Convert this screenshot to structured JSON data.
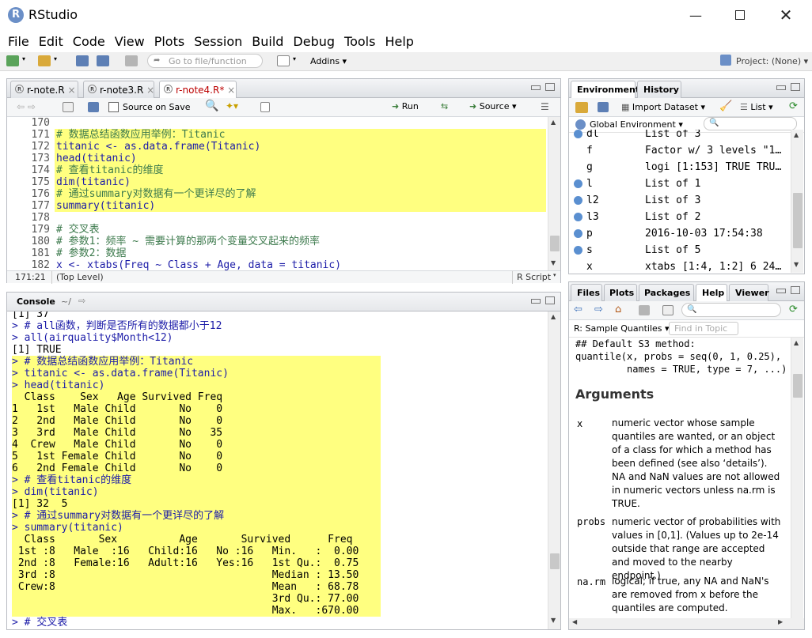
{
  "app": {
    "title": "RStudio"
  },
  "menu": [
    "File",
    "Edit",
    "Code",
    "View",
    "Plots",
    "Session",
    "Build",
    "Debug",
    "Tools",
    "Help"
  ],
  "toolbar": {
    "goto_placeholder": "Go to file/function",
    "addins": "Addins",
    "project": "Project: (None)"
  },
  "editor": {
    "tabs": [
      "r-note.R",
      "r-note3.R",
      "r-note4.R*"
    ],
    "source_on_save": "Source on Save",
    "run": "Run",
    "source": "Source",
    "lines": [
      {
        "n": "170",
        "t": "",
        "cls": ""
      },
      {
        "n": "171",
        "t": "# 数据总结函数应用举例：Titanic",
        "cls": "comment hl"
      },
      {
        "n": "172",
        "t": "titanic <- as.data.frame(Titanic)",
        "cls": "code hl"
      },
      {
        "n": "173",
        "t": "head(titanic)",
        "cls": "code hl"
      },
      {
        "n": "174",
        "t": "# 查看titanic的维度",
        "cls": "comment hl"
      },
      {
        "n": "175",
        "t": "dim(titanic)",
        "cls": "code hl"
      },
      {
        "n": "176",
        "t": "# 通过summary对数据有一个更详尽的了解",
        "cls": "comment hl"
      },
      {
        "n": "177",
        "t": "summary(titanic)",
        "cls": "code hl"
      },
      {
        "n": "178",
        "t": "",
        "cls": ""
      },
      {
        "n": "179",
        "t": "# 交叉表",
        "cls": "comment"
      },
      {
        "n": "180",
        "t": "# 参数1：频率 ~ 需要计算的那两个变量交叉起来的频率",
        "cls": "comment"
      },
      {
        "n": "181",
        "t": "# 参数2：数据",
        "cls": "comment"
      },
      {
        "n": "182",
        "t": "x <- xtabs(Freq ~ Class + Age, data = titanic)",
        "cls": "code"
      }
    ],
    "status_pos": "171:21",
    "status_level": "(Top Level)",
    "status_type": "R Script"
  },
  "console": {
    "title": "Console",
    "path": "~/",
    "lines": [
      {
        "t": "[1] 37",
        "cls": "out"
      },
      {
        "t": "> # all函数，判断是否所有的数据都小于12",
        "cls": "prompt-in"
      },
      {
        "t": "> all(airquality$Month<12)",
        "cls": "prompt-in"
      },
      {
        "t": "[1] TRUE",
        "cls": "out"
      },
      {
        "t": "> # 数据总结函数应用举例：Titanic",
        "cls": "prompt-in hl"
      },
      {
        "t": "> titanic <- as.data.frame(Titanic)",
        "cls": "prompt-in hl"
      },
      {
        "t": "> head(titanic)",
        "cls": "prompt-in hl"
      },
      {
        "t": "  Class    Sex   Age Survived Freq",
        "cls": "out hl"
      },
      {
        "t": "1   1st   Male Child       No    0",
        "cls": "out hl"
      },
      {
        "t": "2   2nd   Male Child       No    0",
        "cls": "out hl"
      },
      {
        "t": "3   3rd   Male Child       No   35",
        "cls": "out hl"
      },
      {
        "t": "4  Crew   Male Child       No    0",
        "cls": "out hl"
      },
      {
        "t": "5   1st Female Child       No    0",
        "cls": "out hl"
      },
      {
        "t": "6   2nd Female Child       No    0",
        "cls": "out hl"
      },
      {
        "t": "> # 查看titanic的维度",
        "cls": "prompt-in hl"
      },
      {
        "t": "> dim(titanic)",
        "cls": "prompt-in hl"
      },
      {
        "t": "[1] 32  5",
        "cls": "out hl"
      },
      {
        "t": "> # 通过summary对数据有一个更详尽的了解",
        "cls": "prompt-in hl"
      },
      {
        "t": "> summary(titanic)",
        "cls": "prompt-in hl"
      },
      {
        "t": "  Class       Sex          Age       Survived      Freq       ",
        "cls": "out hl"
      },
      {
        "t": " 1st :8   Male  :16   Child:16   No :16   Min.   :  0.00  ",
        "cls": "out hl"
      },
      {
        "t": " 2nd :8   Female:16   Adult:16   Yes:16   1st Qu.:  0.75  ",
        "cls": "out hl"
      },
      {
        "t": " 3rd :8                                   Median : 13.50  ",
        "cls": "out hl"
      },
      {
        "t": " Crew:8                                   Mean   : 68.78  ",
        "cls": "out hl"
      },
      {
        "t": "                                          3rd Qu.: 77.00  ",
        "cls": "out hl"
      },
      {
        "t": "                                          Max.   :670.00  ",
        "cls": "out hl"
      },
      {
        "t": "> # 交叉表",
        "cls": "prompt-in"
      }
    ]
  },
  "env": {
    "tabs": [
      "Environment",
      "History"
    ],
    "import_dataset": "Import Dataset",
    "list_view": "List",
    "scope": "Global Environment",
    "rows": [
      {
        "name": "dl",
        "val": "List of 3",
        "dot": true
      },
      {
        "name": "f",
        "val": "Factor w/ 3 levels \"1…",
        "dot": false
      },
      {
        "name": "g",
        "val": "logi [1:153] TRUE TRU…",
        "dot": false
      },
      {
        "name": "l",
        "val": "List of 1",
        "dot": true
      },
      {
        "name": "l2",
        "val": "List of 3",
        "dot": true
      },
      {
        "name": "l3",
        "val": "List of 2",
        "dot": true
      },
      {
        "name": "p",
        "val": "2016-10-03 17:54:38",
        "dot": true
      },
      {
        "name": "s",
        "val": "List of 5",
        "dot": true
      },
      {
        "name": "x",
        "val": "xtabs [1:4, 1:2] 6 24…",
        "dot": false
      }
    ]
  },
  "help": {
    "tabs": [
      "Files",
      "Plots",
      "Packages",
      "Help",
      "Viewer"
    ],
    "topic": "R: Sample Quantiles",
    "find_placeholder": "Find in Topic",
    "code1": "## Default S3 method:",
    "code2": "quantile(x, probs = seq(0, 1, 0.25),",
    "code3": "         names = TRUE, type = 7, ...)",
    "arguments_heading": "Arguments",
    "args": [
      {
        "name": "x",
        "desc": "numeric vector whose sample quantiles are wanted, or an object of a class for which a method has been defined (see also ‘details’). NA and NaN values are not allowed in numeric vectors unless na.rm is TRUE."
      },
      {
        "name": "probs",
        "desc": "numeric vector of probabilities with values in [0,1]. (Values up to 2e-14 outside that range are accepted and moved to the nearby endpoint.)"
      },
      {
        "name": "na.rm",
        "desc": "logical; if true, any NA and NaN's are removed from x before the quantiles are computed."
      }
    ]
  },
  "colors": {
    "highlight": "#ffff80",
    "code": "#1c1ca8",
    "comment": "#3d7a4d"
  }
}
